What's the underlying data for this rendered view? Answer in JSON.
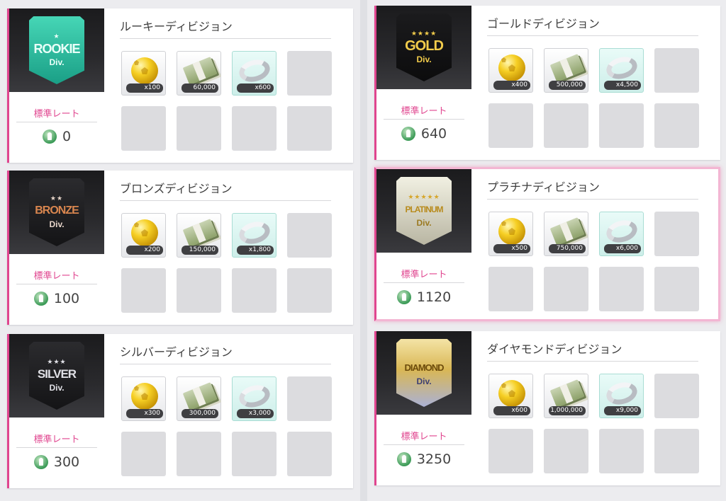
{
  "rate_label": "標準レート",
  "divisions": [
    {
      "id": "rookie",
      "title": "ルーキーディビジョン",
      "badge": {
        "tier": "ROOKIE",
        "div": "Div.",
        "stars": "★"
      },
      "rate": "0",
      "rewards": {
        "coins": "x100",
        "money": "60,000",
        "rings": "x600"
      }
    },
    {
      "id": "bronze",
      "title": "ブロンズディビジョン",
      "badge": {
        "tier": "BRONZE",
        "div": "Div.",
        "stars": "★★"
      },
      "rate": "100",
      "rewards": {
        "coins": "x200",
        "money": "150,000",
        "rings": "x1,800"
      }
    },
    {
      "id": "silver",
      "title": "シルバーディビジョン",
      "badge": {
        "tier": "SILVER",
        "div": "Div.",
        "stars": "★★★"
      },
      "rate": "300",
      "rewards": {
        "coins": "x300",
        "money": "300,000",
        "rings": "x3,000"
      }
    },
    {
      "id": "gold",
      "title": "ゴールドディビジョン",
      "badge": {
        "tier": "GOLD",
        "div": "Div.",
        "stars": "★★★★"
      },
      "rate": "640",
      "rewards": {
        "coins": "x400",
        "money": "500,000",
        "rings": "x4,500"
      }
    },
    {
      "id": "platinum",
      "title": "プラチナディビジョン",
      "badge": {
        "tier": "PLATINUM",
        "div": "Div.",
        "stars": "★★★★★"
      },
      "rate": "1120",
      "rewards": {
        "coins": "x500",
        "money": "750,000",
        "rings": "x6,000"
      }
    },
    {
      "id": "diamond",
      "title": "ダイヤモンドディビジョン",
      "badge": {
        "tier": "DIAMOND",
        "div": "Div.",
        "stars": ""
      },
      "rate": "3250",
      "rewards": {
        "coins": "x600",
        "money": "1,000,000",
        "rings": "x9,000"
      }
    }
  ],
  "icons": {
    "coin": "gold-ball-icon",
    "money": "cash-stack-icon",
    "ring": "silver-ring-icon",
    "rate": "rate-trophy-icon"
  },
  "colors": {
    "accent": "#e0458f",
    "highlight_border": "#f3b6d3"
  }
}
